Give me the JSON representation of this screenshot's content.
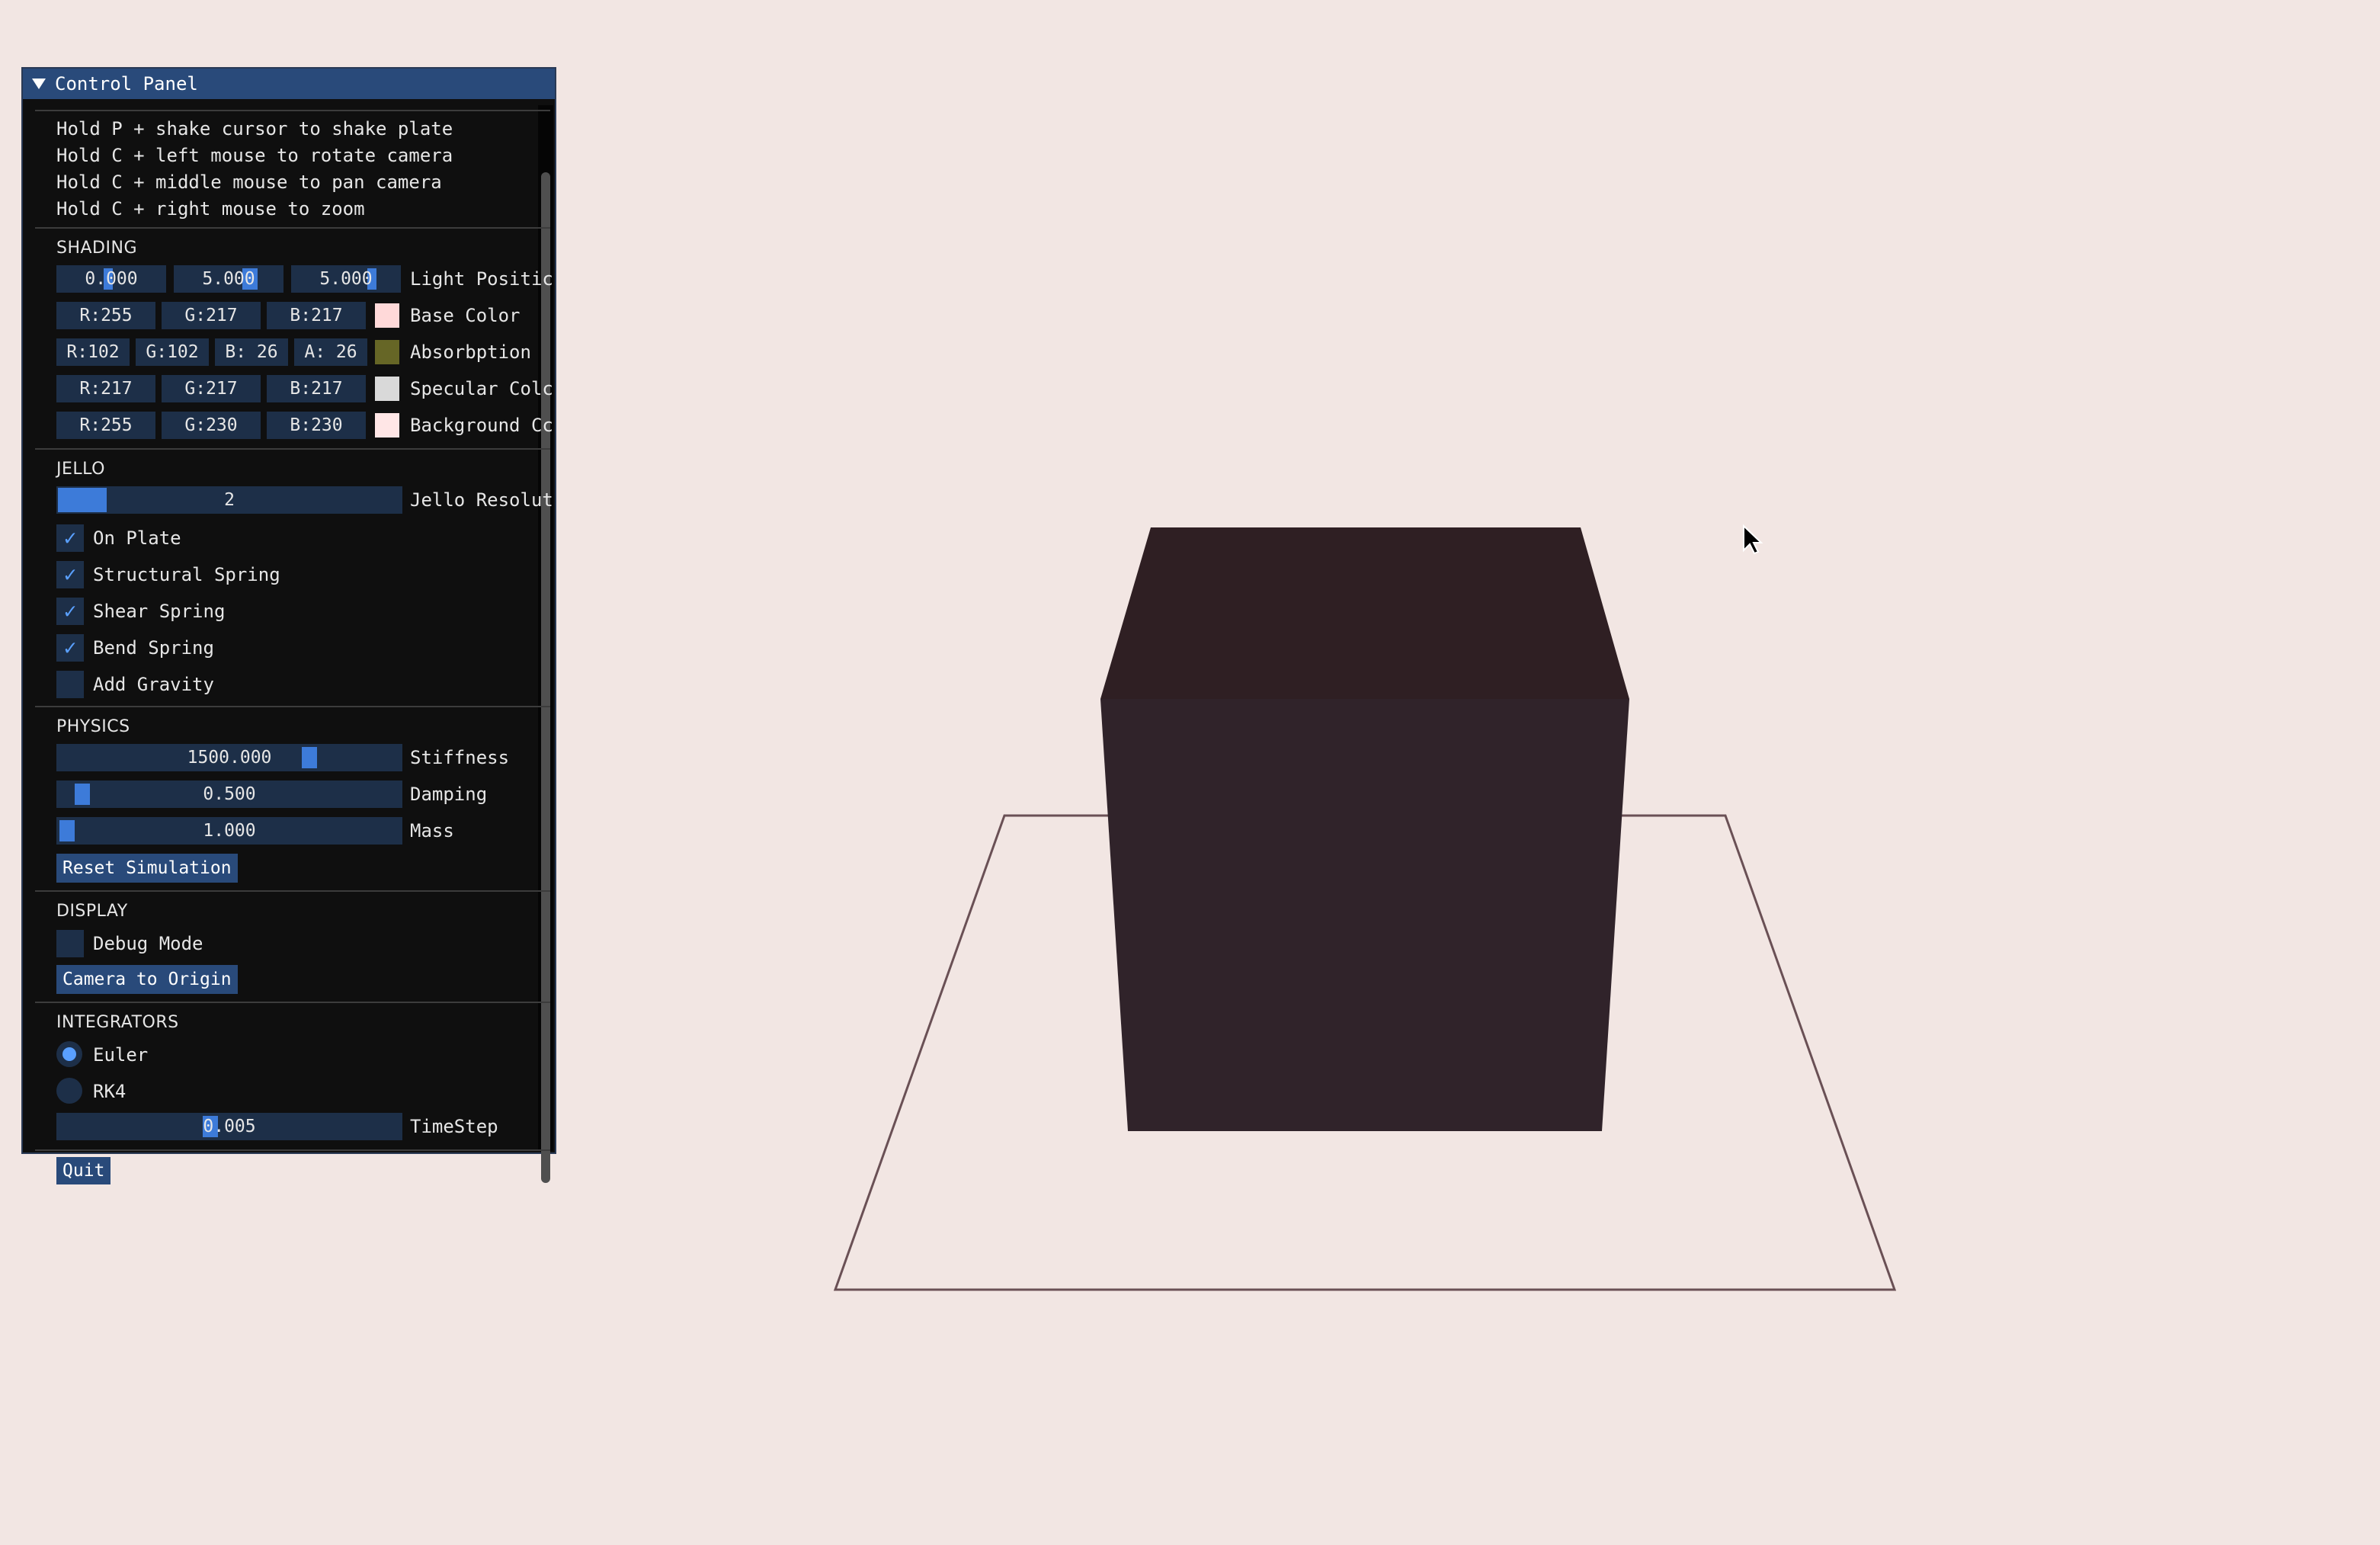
{
  "panel": {
    "title": "Control Panel",
    "help": [
      "Hold P + shake cursor to shake plate",
      "Hold C + left mouse to rotate camera",
      "Hold C + middle mouse to pan camera",
      "Hold C + right mouse to zoom"
    ]
  },
  "shading": {
    "heading": "SHADING",
    "light_position": {
      "x": "0.000",
      "y": "5.000",
      "z": "5.000",
      "label": "Light Positic"
    },
    "base_color": {
      "r": "R:255",
      "g": "G:217",
      "b": "B:217",
      "label": "Base Color",
      "hex": "#ffd9d9"
    },
    "absorbption": {
      "r": "R:102",
      "g": "G:102",
      "b": "B: 26",
      "a": "A: 26",
      "label": "Absorbption",
      "hex": "#666626"
    },
    "specular_color": {
      "r": "R:217",
      "g": "G:217",
      "b": "B:217",
      "label": "Specular Colc",
      "hex": "#d9d9d9"
    },
    "background_color": {
      "r": "R:255",
      "g": "G:230",
      "b": "B:230",
      "label": "Background Cc",
      "hex": "#ffe6e6"
    }
  },
  "jello": {
    "heading": "JELLO",
    "resolution": {
      "value": "2",
      "label": "Jello Resolut",
      "fraction": 0.15
    },
    "on_plate": {
      "label": "On Plate",
      "checked": "✓"
    },
    "structural_spring": {
      "label": "Structural Spring",
      "checked": "✓"
    },
    "shear_spring": {
      "label": "Shear Spring",
      "checked": "✓"
    },
    "bend_spring": {
      "label": "Bend Spring",
      "checked": "✓"
    },
    "add_gravity": {
      "label": "Add Gravity",
      "checked": ""
    }
  },
  "physics": {
    "heading": "PHYSICS",
    "stiffness": {
      "value": "1500.000",
      "label": "Stiffness"
    },
    "damping": {
      "value": "0.500",
      "label": "Damping"
    },
    "mass": {
      "value": "1.000",
      "label": "Mass"
    },
    "reset_button": "Reset Simulation"
  },
  "display": {
    "heading": "DISPLAY",
    "debug_mode": {
      "label": "Debug Mode",
      "checked": ""
    },
    "camera_button": "Camera to Origin"
  },
  "integrators": {
    "heading": "INTEGRATORS",
    "euler": {
      "label": "Euler",
      "selected": true
    },
    "rk4": {
      "label": "RK4",
      "selected": false
    },
    "timestep": {
      "value": "0.005",
      "label": "TimeStep"
    }
  },
  "quit_button": "Quit",
  "colors": {
    "accent": "#3d7bd9",
    "title_bar": "#294a7a",
    "frame_bg": "#1d2f48",
    "cube_top": "#2f1f23",
    "cube_front": "#30232a",
    "plate_line": "#6a5055"
  }
}
